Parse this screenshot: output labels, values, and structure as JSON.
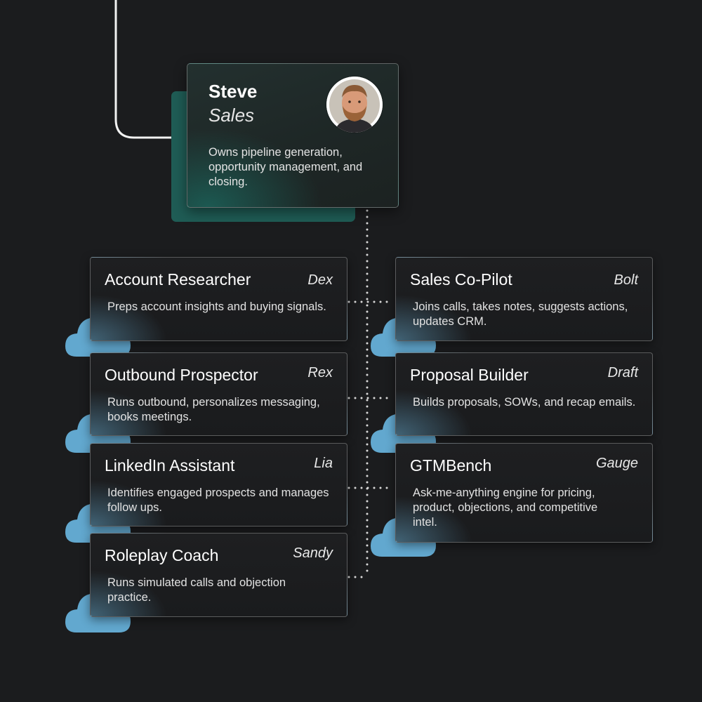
{
  "lead": {
    "name": "Steve",
    "role": "Sales",
    "description": "Owns pipeline generation, opportunity management, and closing."
  },
  "agents_left": [
    {
      "title": "Account Researcher",
      "agent": "Dex",
      "description": "Preps account insights and buying signals."
    },
    {
      "title": "Outbound Prospector",
      "agent": "Rex",
      "description": "Runs outbound, personalizes messaging, books meetings."
    },
    {
      "title": "LinkedIn Assistant",
      "agent": "Lia",
      "description": "Identifies engaged prospects and manages follow ups."
    },
    {
      "title": "Roleplay Coach",
      "agent": "Sandy",
      "description": "Runs simulated calls and objection practice."
    }
  ],
  "agents_right": [
    {
      "title": "Sales Co-Pilot",
      "agent": "Bolt",
      "description": "Joins calls, takes notes, suggests actions, updates CRM."
    },
    {
      "title": "Proposal Builder",
      "agent": "Draft",
      "description": "Builds proposals, SOWs, and recap emails."
    },
    {
      "title": "GTMBench",
      "agent": "Gauge",
      "description": "Ask-me-anything engine for pricing, product, objections, and competitive intel."
    }
  ],
  "colors": {
    "background": "#1b1c1e",
    "lead_accent": "#1f5c55",
    "agent_accent": "#5fa2c6",
    "connector": "#e8e8e8"
  },
  "icons": [
    "avatar-photo",
    "cloud-icon"
  ]
}
